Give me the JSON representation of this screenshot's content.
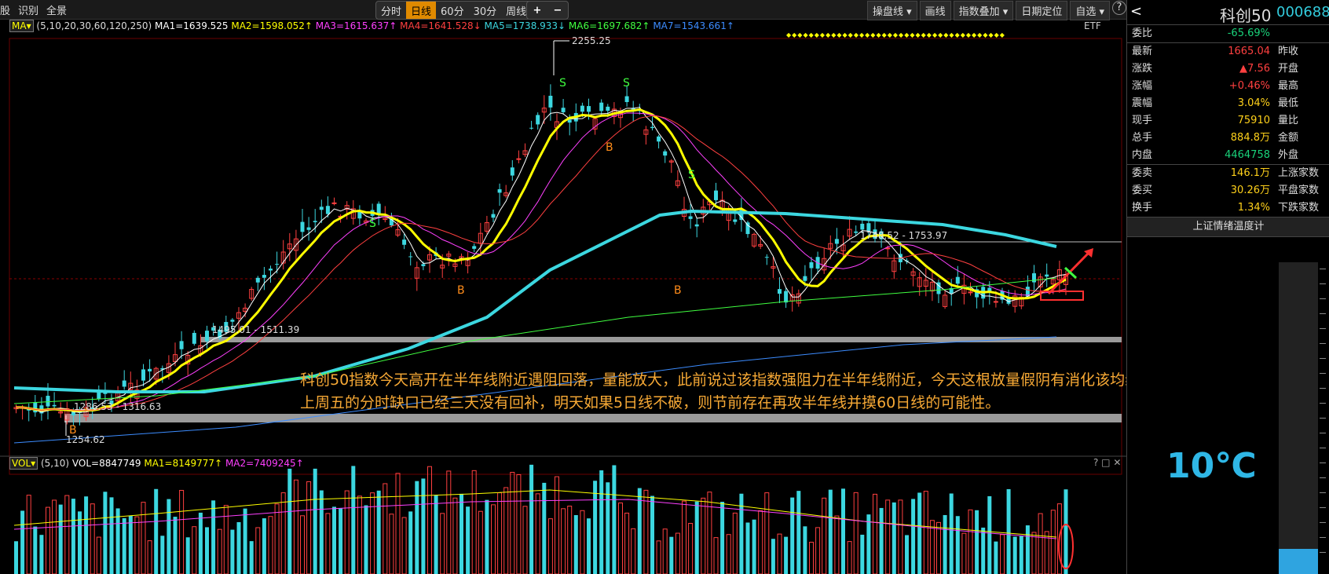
{
  "toolbar": {
    "left": [
      "股",
      "识别",
      "全景"
    ],
    "periods": [
      "分时",
      "日线",
      "60分",
      "30分",
      "周线 ▾"
    ],
    "active_period": "日线",
    "zoom_in": "+",
    "zoom_out": "−",
    "right": [
      "操盘线 ▾",
      "画线",
      "指数叠加 ▾",
      "日期定位",
      "自选 ▾"
    ],
    "help": "?"
  },
  "ma_legend": {
    "tag": "MA▾",
    "params": "(5,10,20,30,60,120,250)",
    "items": [
      {
        "t": "MA1=1639.525",
        "c": "#ffffff"
      },
      {
        "t": "MA2=1598.052↑",
        "c": "#ffff00"
      },
      {
        "t": "MA3=1615.637↑",
        "c": "#ff40ff"
      },
      {
        "t": "MA4=1641.528↓",
        "c": "#ff4040"
      },
      {
        "t": "MA5=1738.933↓",
        "c": "#3cd7e0"
      },
      {
        "t": "MA6=1697.682↑",
        "c": "#40ff40"
      },
      {
        "t": "MA7=1543.661↑",
        "c": "#3c8cff"
      }
    ]
  },
  "etf": "ETF",
  "dots": "◆◆◆◆◆◆◆◆◆◆◆◆◆◆◆◆◆◆◆◆◆◆◆◆◆◆◆◆◆◆◆◆◆◆◆◆◆◆◆",
  "chart_data": {
    "type": "candlestick",
    "price_labels": {
      "high": "2255.25",
      "low": "1254.62",
      "zone_upper": "1495.01 - 1511.39",
      "zone_lower": "1286.53 - 1316.63",
      "zone_top": "1748.52 - 1753.97"
    },
    "signals": [
      "S",
      "S",
      "S",
      "S",
      "B",
      "B",
      "B",
      "B"
    ]
  },
  "annotation": "科创50指数今天高开在半年线附近遇阻回落，量能放大，此前说过该指数强阻力在半年线附近，今天这根放量假阴有消化该均线压力的意思。目前该指数上周五的分时缺口已经三天没有回补，明天如果5日线不破，则节前存在再攻半年线并摸60日线的可能性。",
  "vol_legend": {
    "tag": "VOL▾",
    "params": "(5,10)",
    "items": [
      {
        "t": "VOL=8847749",
        "c": "#ffffff"
      },
      {
        "t": "MA1=8149777↑",
        "c": "#ffff00"
      },
      {
        "t": "MA2=7409245↑",
        "c": "#ff40ff"
      }
    ],
    "controls": "? □ ✕"
  },
  "panel": {
    "back": "<",
    "name": "科创50",
    "code": "000688",
    "rows1": [
      {
        "k": "委比",
        "v": "-65.69%",
        "c": "grn",
        "k2": ""
      }
    ],
    "rows2": [
      {
        "k": "最新",
        "v": "1665.04",
        "c": "red",
        "k2": "昨收"
      },
      {
        "k": "涨跌",
        "v": "▲7.56",
        "c": "red",
        "k2": "开盘"
      },
      {
        "k": "涨幅",
        "v": "+0.46%",
        "c": "red",
        "k2": "最高"
      },
      {
        "k": "震幅",
        "v": "3.04%",
        "c": "yel",
        "k2": "最低"
      },
      {
        "k": "现手",
        "v": "75910",
        "c": "yel",
        "k2": "量比"
      },
      {
        "k": "总手",
        "v": "884.8万",
        "c": "yel",
        "k2": "金额"
      },
      {
        "k": "内盘",
        "v": "4464758",
        "c": "grn",
        "k2": "外盘"
      }
    ],
    "rows3": [
      {
        "k": "委卖",
        "v": "146.1万",
        "c": "yel",
        "k2": "上涨家数"
      },
      {
        "k": "委买",
        "v": "30.26万",
        "c": "yel",
        "k2": "平盘家数"
      },
      {
        "k": "换手",
        "v": "1.34%",
        "c": "yel",
        "k2": "下跌家数"
      }
    ],
    "temp_title": "上证情绪温度计",
    "temperature": "10℃",
    "temp_level": 0.08
  }
}
